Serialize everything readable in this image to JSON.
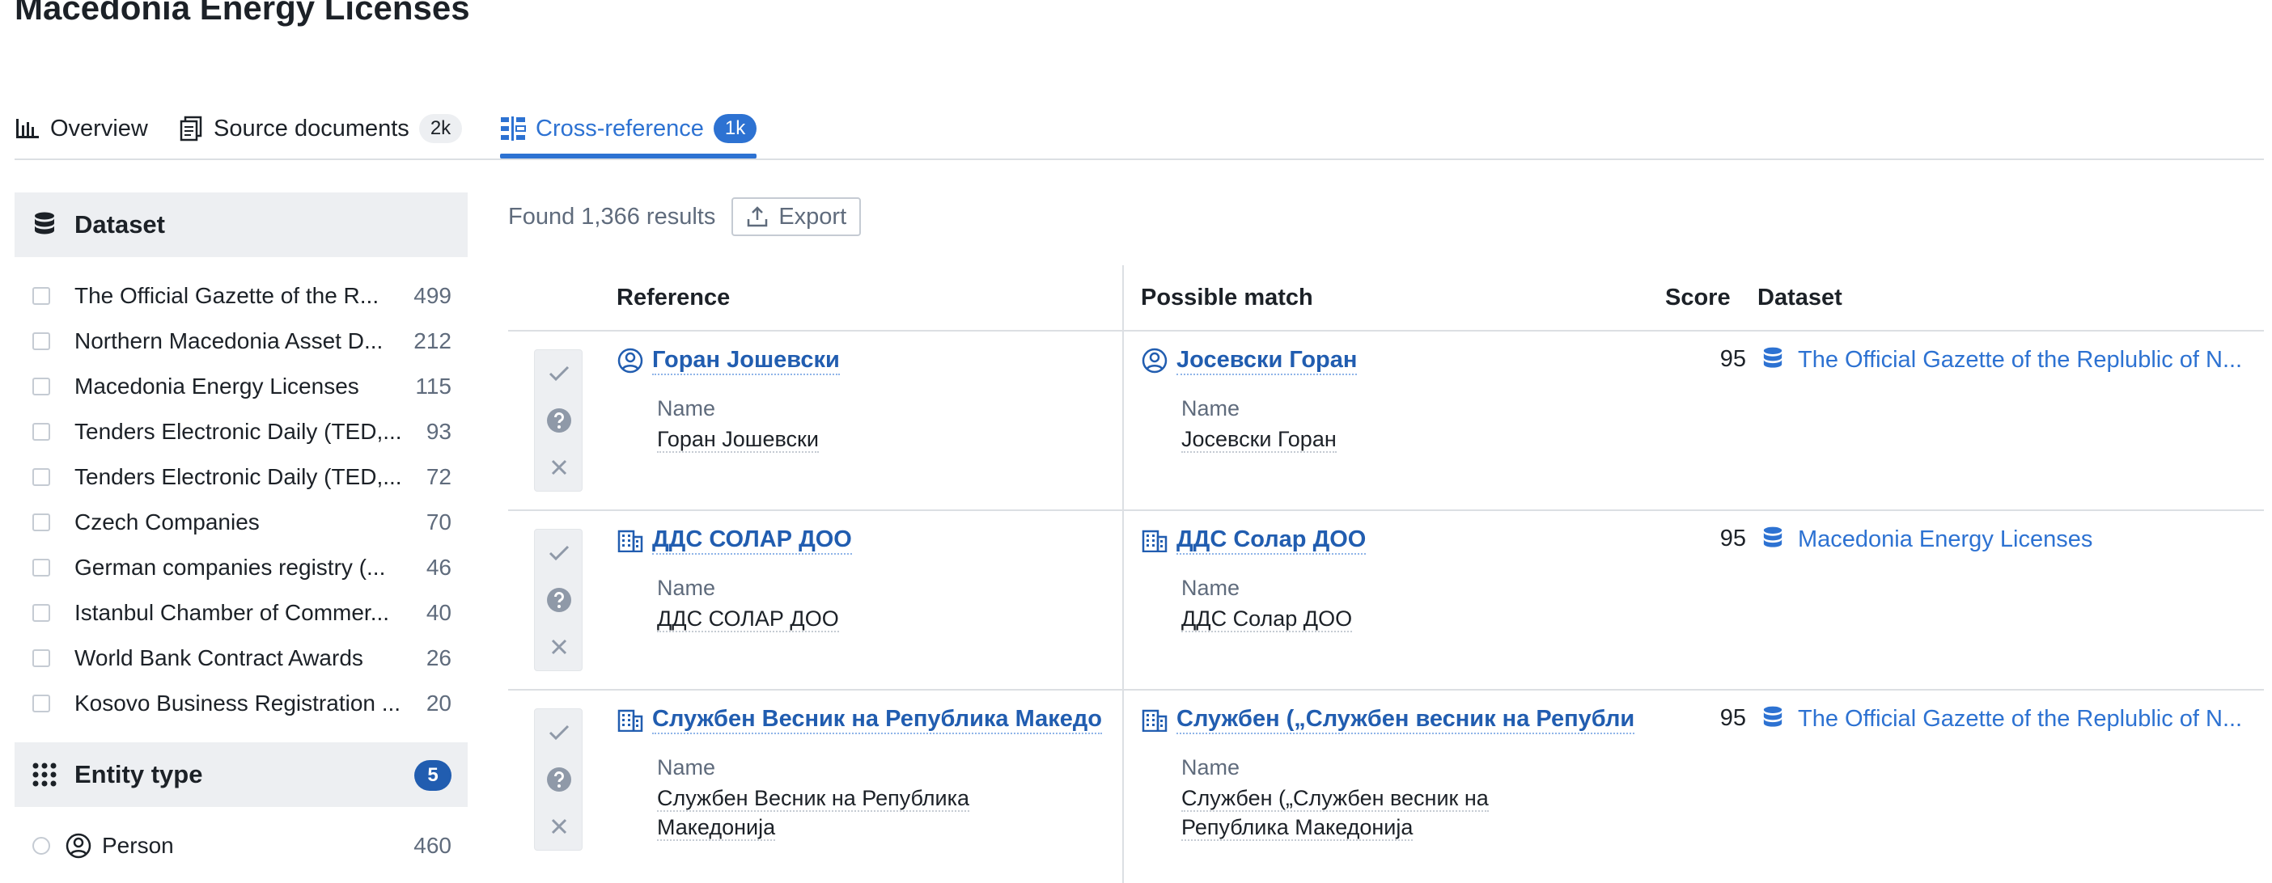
{
  "page": {
    "title": "Macedonia Energy Licenses"
  },
  "tabs": [
    {
      "label": "Overview",
      "icon": "bar-chart-icon",
      "badge": null,
      "active": false
    },
    {
      "label": "Source documents",
      "icon": "documents-icon",
      "badge": "2k",
      "active": false
    },
    {
      "label": "Cross-reference",
      "icon": "cross-reference-icon",
      "badge": "1k",
      "active": true
    }
  ],
  "facets": {
    "dataset": {
      "title": "Dataset",
      "icon": "database-icon",
      "items": [
        {
          "label": "The Official Gazette of the R...",
          "count": "499"
        },
        {
          "label": "Northern Macedonia Asset D...",
          "count": "212"
        },
        {
          "label": "Macedonia Energy Licenses",
          "count": "115"
        },
        {
          "label": "Tenders Electronic Daily (TED,...",
          "count": "93"
        },
        {
          "label": "Tenders Electronic Daily (TED,...",
          "count": "72"
        },
        {
          "label": "Czech Companies",
          "count": "70"
        },
        {
          "label": "German companies registry (...",
          "count": "46"
        },
        {
          "label": "Istanbul Chamber of Commer...",
          "count": "40"
        },
        {
          "label": "World Bank Contract Awards",
          "count": "26"
        },
        {
          "label": "Kosovo Business Registration ...",
          "count": "20"
        }
      ]
    },
    "entity_type": {
      "title": "Entity type",
      "icon": "grid-dots-icon",
      "badge": "5",
      "items": [
        {
          "label": "Person",
          "count": "460",
          "icon": "person-icon"
        }
      ]
    }
  },
  "results": {
    "found_text": "Found 1,366 results",
    "export_label": "Export"
  },
  "table": {
    "headers": {
      "reference": "Reference",
      "match": "Possible match",
      "score": "Score",
      "dataset": "Dataset"
    },
    "rows": [
      {
        "reference": {
          "name": "Горан Јошевски",
          "icon": "person-icon",
          "prop_label": "Name",
          "prop_value": "Горан Јошевски"
        },
        "match": {
          "name": "Јосевски Горан",
          "icon": "person-icon",
          "prop_label": "Name",
          "prop_value": "Јосевски Горан"
        },
        "score": "95",
        "dataset": "The Official Gazette of the Replublic of N..."
      },
      {
        "reference": {
          "name": "ДДС СОЛАР ДОО",
          "icon": "company-icon",
          "prop_label": "Name",
          "prop_value": "ДДС СОЛАР ДОО"
        },
        "match": {
          "name": "ДДС Солар ДОО",
          "icon": "company-icon",
          "prop_label": "Name",
          "prop_value": "ДДС Солар ДОО"
        },
        "score": "95",
        "dataset": "Macedonia Energy Licenses"
      },
      {
        "reference": {
          "name": "Службен Весник на Република Македо",
          "icon": "company-icon",
          "prop_label": "Name",
          "prop_value_1": "Службен Весник на Република",
          "prop_value_2": "Македонија"
        },
        "match": {
          "name": "Службен („Службен весник на Републи",
          "icon": "company-icon",
          "prop_label": "Name",
          "prop_value_1": "Службен („Службен весник на",
          "prop_value_2": "Република Македонија"
        },
        "score": "95",
        "dataset": "The Official Gazette of the Replublic of N..."
      }
    ]
  },
  "colors": {
    "accent": "#2d72d2",
    "link": "#215db0",
    "muted": "#5f6b7c",
    "panel": "#edeff2",
    "border": "#dcdfe3"
  }
}
